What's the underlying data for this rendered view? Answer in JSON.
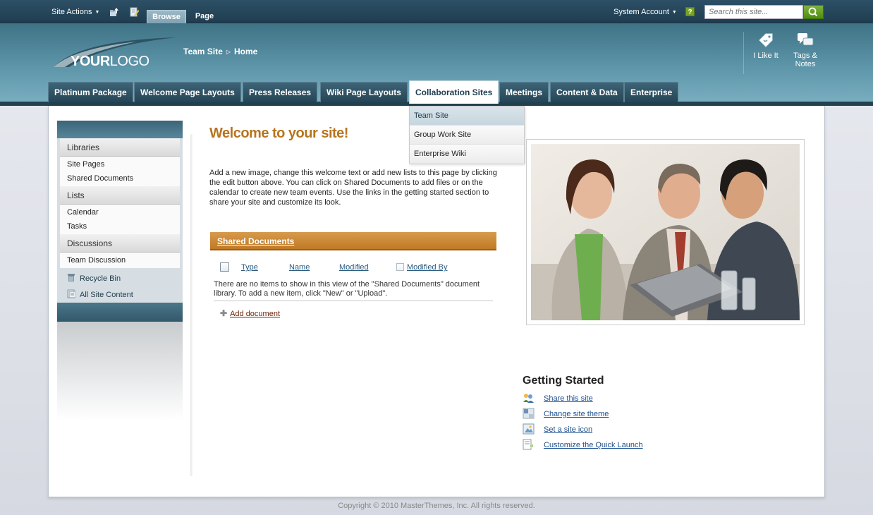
{
  "ribbon": {
    "site_actions": "Site Actions",
    "tabs": [
      "Browse",
      "Page"
    ],
    "account": "System Account",
    "help": "?",
    "search_placeholder": "Search this site..."
  },
  "header": {
    "logo": {
      "bold": "YOUR",
      "light": "LOGO"
    },
    "breadcrumb": [
      "Team Site",
      "Home"
    ],
    "social": [
      {
        "label": "I Like It"
      },
      {
        "label": "Tags & Notes"
      }
    ]
  },
  "topnav": [
    "Platinum Package",
    "Welcome Page Layouts",
    "Press Releases",
    "Wiki Page Layouts",
    "Collaboration Sites",
    "Meetings",
    "Content & Data",
    "Enterprise"
  ],
  "topnav_active": "Collaboration Sites",
  "dropdown": [
    "Team Site",
    "Group Work Site",
    "Enterprise Wiki"
  ],
  "quicklaunch": {
    "libraries": {
      "heading": "Libraries",
      "items": [
        "Site Pages",
        "Shared Documents"
      ]
    },
    "lists": {
      "heading": "Lists",
      "items": [
        "Calendar",
        "Tasks"
      ]
    },
    "discussions": {
      "heading": "Discussions",
      "items": [
        "Team Discussion"
      ]
    },
    "recycle_bin": "Recycle Bin",
    "all_site_content": "All Site Content"
  },
  "main": {
    "title": "Welcome to your site!",
    "intro": "Add a new image, change this welcome text or add new lists to this page by clicking the edit button above. You can click on Shared Documents to add files or on the calendar to create new team events. Use the links in the getting started section to share your site and customize its look.",
    "library": {
      "title": "Shared Documents",
      "columns": [
        "Type",
        "Name",
        "Modified",
        "Modified By"
      ],
      "empty_message": "There are no items to show in this view of the \"Shared Documents\" document library. To add a new item, click \"New\" or \"Upload\".",
      "add_label": "Add document"
    }
  },
  "getting_started": {
    "title": "Getting Started",
    "links": [
      "Share this site",
      "Change site theme",
      "Set a site icon",
      "Customize the Quick Launch"
    ]
  },
  "footer": "Copyright © 2010 MasterThemes, Inc. All rights reserved.",
  "colors": {
    "ribbon": "#1f3d50",
    "header": "#5d95a9",
    "accent_orange": "#c07a26",
    "title_orange": "#b8741f",
    "link_blue": "#1d4f8f"
  }
}
